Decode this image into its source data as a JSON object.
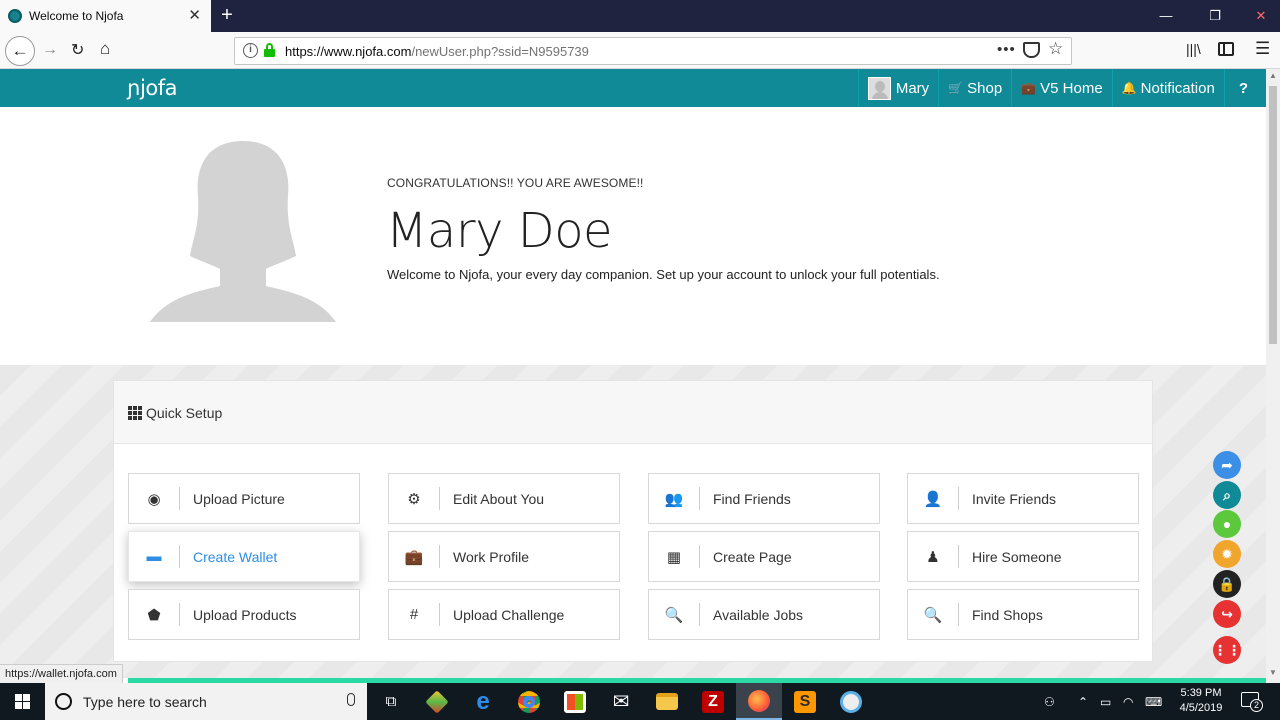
{
  "browser": {
    "tab_title": "Welcome to Njofa",
    "url_host": "https://www.njofa.com",
    "url_path": "/newUser.php?ssid=N9595739",
    "status_url": "https://wallet.njofa.com"
  },
  "site": {
    "logo": "ɲjofa",
    "nav": {
      "user": "Mary",
      "shop": "Shop",
      "v5_home": "V5 Home",
      "notification": "Notification",
      "help": "?"
    }
  },
  "profile": {
    "congrats": "CONGRATULATIONS!! YOU ARE AWESOME!!",
    "name": "Mary Doe",
    "welcome": "Welcome to Njofa, your every day companion. Set up your account to unlock your full potentials."
  },
  "quick_setup": {
    "title": "Quick Setup",
    "items": [
      {
        "label": "Upload Picture",
        "icon": "camera-icon",
        "glyph": "◉"
      },
      {
        "label": "Edit About You",
        "icon": "gears-icon",
        "glyph": "⚙"
      },
      {
        "label": "Find Friends",
        "icon": "users-icon",
        "glyph": "👥"
      },
      {
        "label": "Invite Friends",
        "icon": "user-plus-icon",
        "glyph": "👤"
      },
      {
        "label": "Create Wallet",
        "icon": "wallet-icon",
        "glyph": "▬"
      },
      {
        "label": "Work Profile",
        "icon": "briefcase-icon",
        "glyph": "💼"
      },
      {
        "label": "Create Page",
        "icon": "building-icon",
        "glyph": "▦"
      },
      {
        "label": "Hire Someone",
        "icon": "user-tie-icon",
        "glyph": "♟"
      },
      {
        "label": "Upload Products",
        "icon": "tag-icon",
        "glyph": "⬟"
      },
      {
        "label": "Upload Challenge",
        "icon": "hashtag-icon",
        "glyph": "#"
      },
      {
        "label": "Available Jobs",
        "icon": "search-dollar-icon",
        "glyph": "🔍"
      },
      {
        "label": "Find Shops",
        "icon": "search-plus-icon",
        "glyph": "🔍"
      }
    ],
    "active_item": "Create Wallet"
  },
  "taskbar": {
    "search_placeholder": "Type here to search",
    "time": "5:39 PM",
    "date": "4/5/2019",
    "notifications": "2"
  },
  "colors": {
    "header": "#0f8a96",
    "accent_link": "#2e8ee6",
    "progress_bar": "#2bd9a4"
  }
}
